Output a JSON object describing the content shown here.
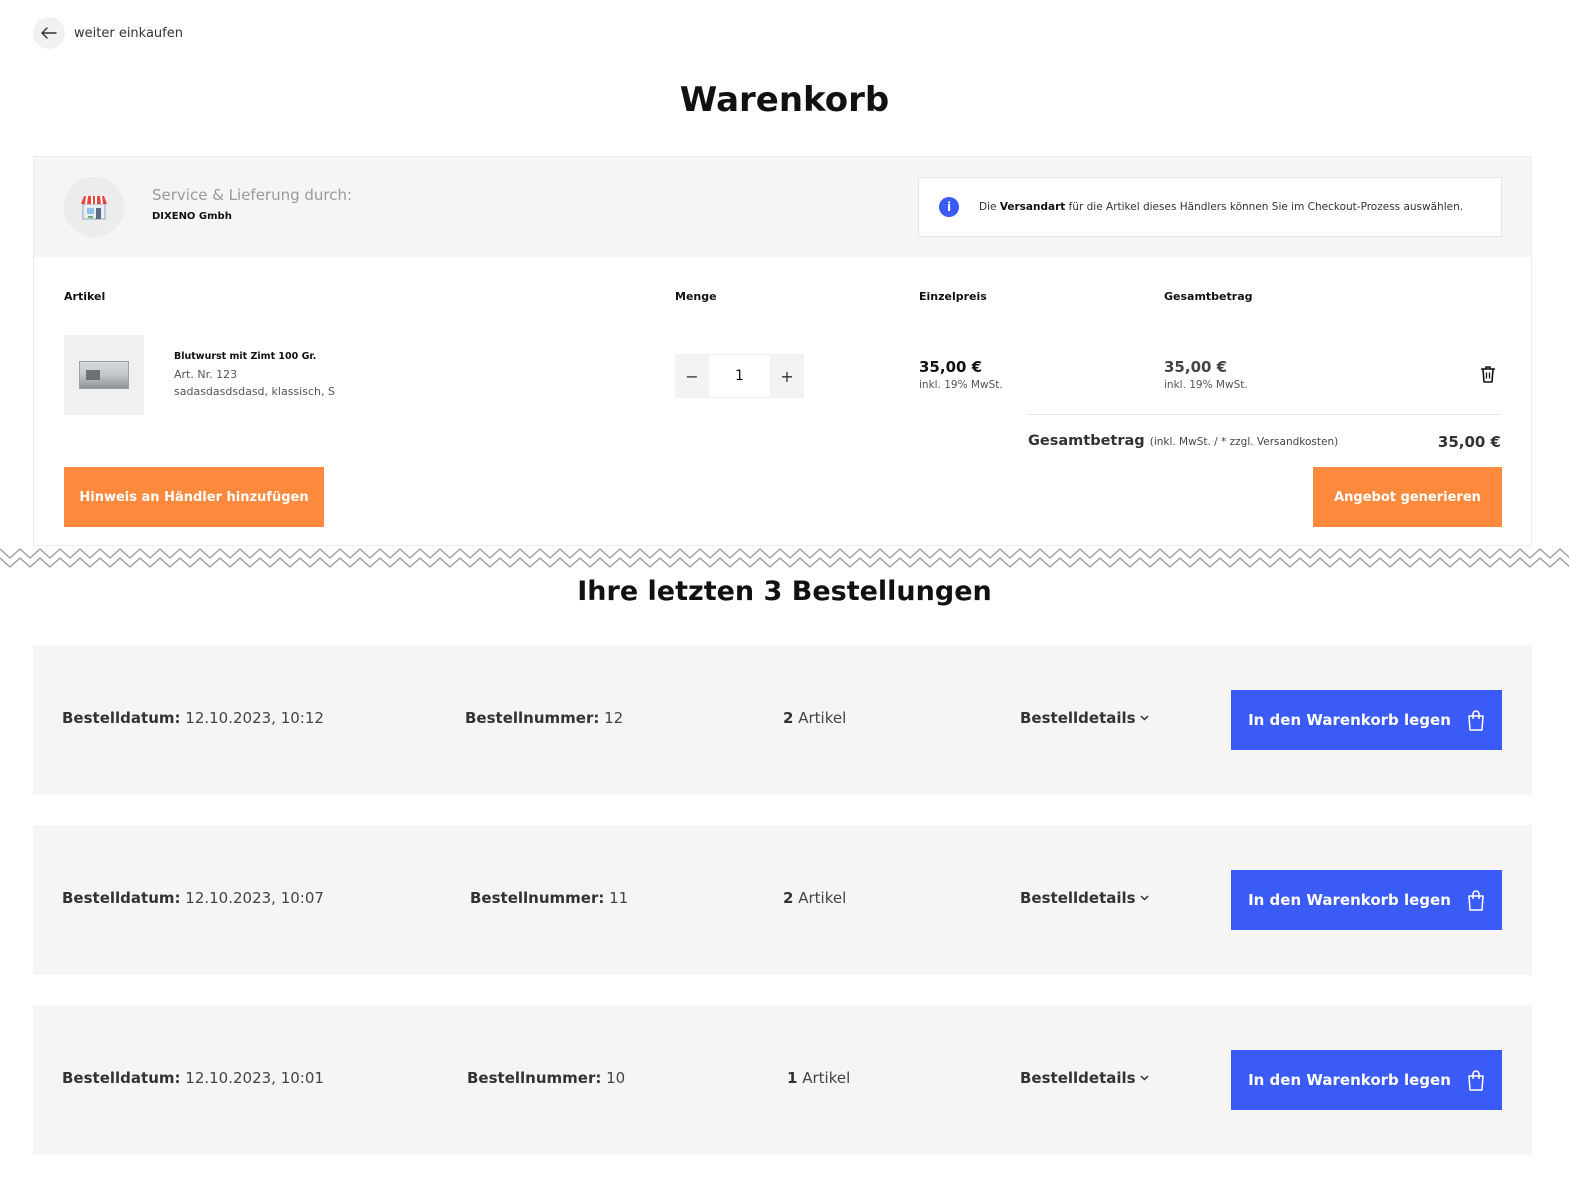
{
  "nav": {
    "back_label": "weiter einkaufen"
  },
  "page": {
    "title": "Warenkorb"
  },
  "merchant": {
    "heading": "Service & Lieferung durch:",
    "name": "DIXENO Gmbh",
    "logo_icon": "shop-icon",
    "info": {
      "prefix": "Die",
      "bold": "Versandart",
      "suffix": "für die Artikel dieses Händlers können Sie im Checkout-Prozess auswählen."
    }
  },
  "table": {
    "headers": {
      "article": "Artikel",
      "quantity": "Menge",
      "unit_price": "Einzelpreis",
      "total": "Gesamtbetrag"
    }
  },
  "item": {
    "name": "Blutwurst mit Zimt 100 Gr.",
    "article_no": "Art. Nr. 123",
    "variant": "sadasdasdsdasd, klassisch, S",
    "quantity": "1",
    "unit_price": "35,00 €",
    "unit_price_note": "inkl. 19% MwSt.",
    "total_price": "35,00 €",
    "total_price_note": "inkl. 19% MwSt."
  },
  "summary": {
    "label": "Gesamtbetrag",
    "note": "(inkl. MwSt. / * zzgl. Versandkosten)",
    "value": "35,00 €"
  },
  "actions": {
    "add_note": "Hinweis an Händler hinzufügen",
    "generate_offer": "Angebot generieren"
  },
  "orders": {
    "title": "Ihre letzten 3 Bestellungen",
    "date_label": "Bestelldatum:",
    "number_label": "Bestellnummer:",
    "items_label": "Artikel",
    "details_label": "Bestelldetails",
    "add_to_cart_label": "In den Warenkorb legen",
    "list": [
      {
        "date": "12.10.2023, 10:12",
        "number": "12",
        "count": "2"
      },
      {
        "date": "12.10.2023, 10:07",
        "number": "11",
        "count": "2"
      },
      {
        "date": "12.10.2023, 10:01",
        "number": "10",
        "count": "1"
      }
    ]
  },
  "colors": {
    "accent_orange": "#ff8a3d",
    "accent_blue": "#3b5bf6",
    "panel_gray": "#f5f5f5"
  }
}
